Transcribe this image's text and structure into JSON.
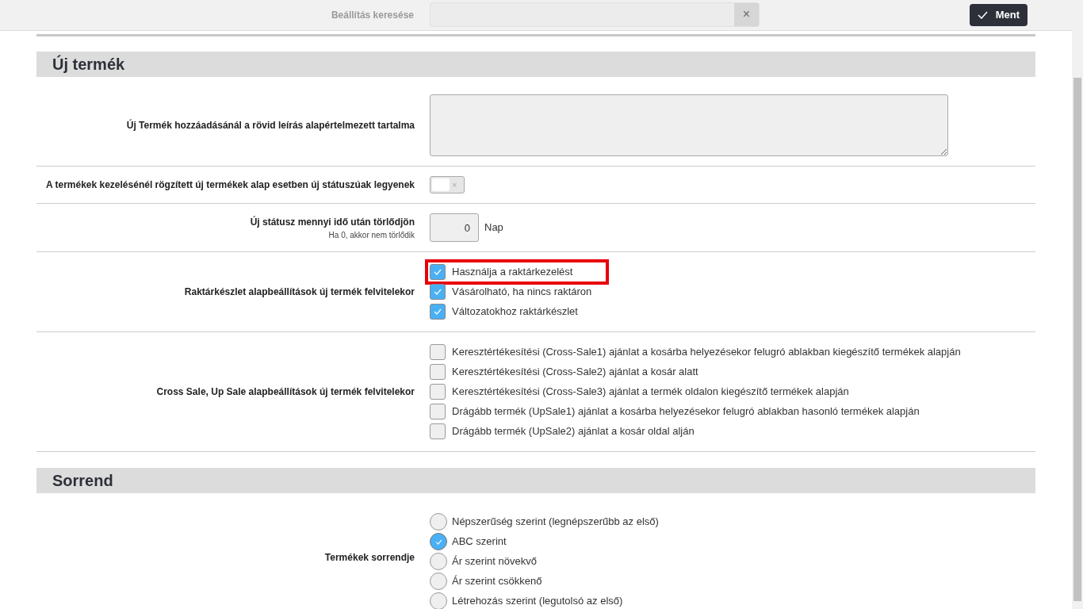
{
  "topbar": {
    "search_label": "Beállítás keresése",
    "clear_icon": "×",
    "save_button": "Ment"
  },
  "sections": [
    {
      "title": "Új termék",
      "rows": [
        {
          "kind": "textarea",
          "label": "Új Termék hozzáadásánál a rövid leírás alapértelmezett tartalma"
        },
        {
          "kind": "toggle",
          "label": "A termékek kezelésénél rögzített új termékek alap esetben új státuszúak legyenek",
          "on": false,
          "off_mark": "×"
        },
        {
          "kind": "number",
          "label": "Új státusz mennyi idő után törlődjön",
          "hint": "Ha 0, akkor nem törlődik",
          "value": "0",
          "unit": "Nap"
        },
        {
          "kind": "checkboxes",
          "label": "Raktárkészlet alapbeállítások új termék felvitelekor",
          "options": [
            {
              "text": "Használja a raktárkezelést",
              "checked": true,
              "highlighted": true
            },
            {
              "text": "Vásárolható, ha nincs raktáron",
              "checked": true,
              "highlighted": false
            },
            {
              "text": "Változatokhoz raktárkészlet",
              "checked": true,
              "highlighted": false
            }
          ]
        },
        {
          "kind": "checkboxes",
          "label": "Cross Sale, Up Sale alapbeállítások új termék felvitelekor",
          "options": [
            {
              "text": "Keresztértékesítési (Cross-Sale1) ajánlat a kosárba helyezésekor felugró ablakban kiegészítő termékek alapján",
              "checked": false,
              "highlighted": false
            },
            {
              "text": "Keresztértékesítési (Cross-Sale2) ajánlat a kosár alatt",
              "checked": false,
              "highlighted": false
            },
            {
              "text": "Keresztértékesítési (Cross-Sale3) ajánlat a termék oldalon kiegészítő termékek alapján",
              "checked": false,
              "highlighted": false
            },
            {
              "text": "Drágább termék (UpSale1) ajánlat a kosárba helyezésekor felugró ablakban hasonló termékek alapján",
              "checked": false,
              "highlighted": false
            },
            {
              "text": "Drágább termék (UpSale2) ajánlat a kosár oldal alján",
              "checked": false,
              "highlighted": false
            }
          ]
        }
      ]
    },
    {
      "title": "Sorrend",
      "rows": [
        {
          "kind": "radios",
          "label": "Termékek sorrendje",
          "options": [
            {
              "text": "Népszerűség szerint (legnépszerűbb az első)",
              "selected": false
            },
            {
              "text": "ABC szerint",
              "selected": true
            },
            {
              "text": "Ár szerint növekvő",
              "selected": false
            },
            {
              "text": "Ár szerint csökkenő",
              "selected": false
            },
            {
              "text": "Létrehozás szerint (legutolsó az első)",
              "selected": false
            }
          ]
        }
      ]
    }
  ]
}
